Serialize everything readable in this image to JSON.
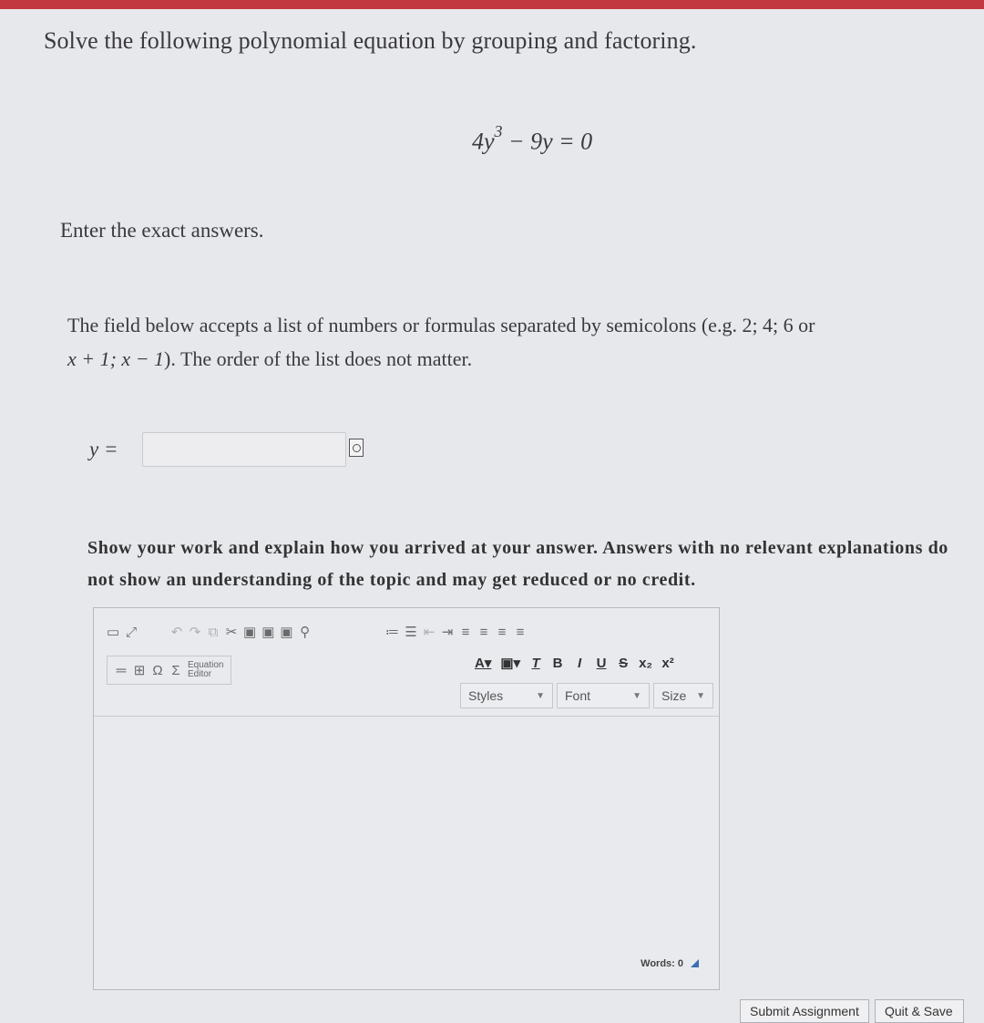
{
  "question": {
    "instruction": "Solve the following polynomial equation by grouping and factoring.",
    "equation": {
      "coef": "4y",
      "exp": "3",
      "rest": " − 9y = 0"
    },
    "exact_note": "Enter the exact answers.",
    "hint_line1": "The field below accepts a list of numbers or formulas separated by semicolons (e.g. 2; 4; 6 or",
    "hint_line2_math": "x + 1; x − 1",
    "hint_line2_text": "). The order of the list does not matter.",
    "answer_label": "y =",
    "answer_value": ""
  },
  "work": {
    "prompt": "Show your work and explain how you arrived at your answer. Answers with no relevant explanations do not show an understanding of the topic and may get reduced or no credit."
  },
  "editor": {
    "equation_editor_line1": "Equation",
    "equation_editor_line2": "Editor",
    "styles_label": "Styles",
    "font_label": "Font",
    "size_label": "Size",
    "words_label": "Words: 0"
  },
  "buttons": {
    "submit": "Submit Assignment",
    "quit_save": "Quit & Save"
  }
}
